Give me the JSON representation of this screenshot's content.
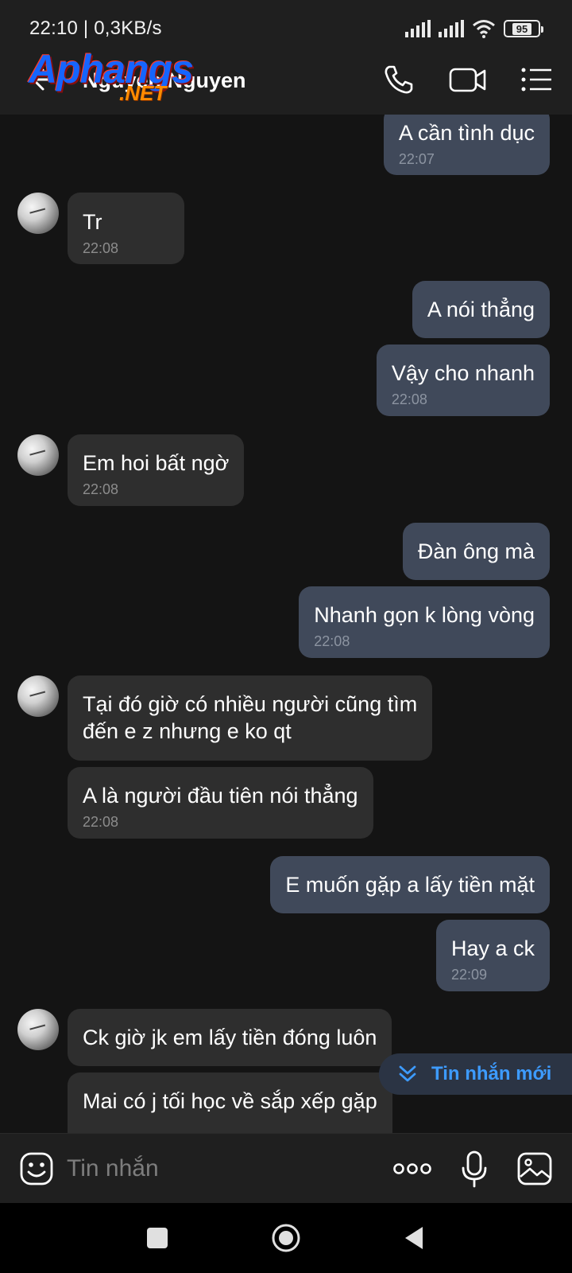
{
  "status_bar": {
    "time_speed": "22:10 | 0,3KB/s",
    "battery": "95"
  },
  "header": {
    "title": "Nguyen Nguyen",
    "watermark_main": "Aphangs",
    "watermark_sub": ".NET",
    "icons": [
      "phone-icon",
      "video-call-icon",
      "menu-list-icon"
    ]
  },
  "messages": [
    {
      "direction": "out",
      "text": "A cần tình dục",
      "time": "22:07"
    },
    {
      "direction": "in",
      "text": "Tr",
      "time": "22:08"
    },
    {
      "direction": "out",
      "text": "A nói thẳng",
      "time": ""
    },
    {
      "direction": "out",
      "text": "Vậy cho nhanh",
      "time": "22:08"
    },
    {
      "direction": "in",
      "text": "Em hoi bất ngờ",
      "time": "22:08"
    },
    {
      "direction": "out",
      "text": "Đàn ông mà",
      "time": ""
    },
    {
      "direction": "out",
      "text": "Nhanh gọn k lòng vòng",
      "time": "22:08"
    },
    {
      "direction": "in",
      "text": "Tại đó giờ có nhiều người cũng tìm\nđến e z nhưng e ko qt",
      "time": ""
    },
    {
      "direction": "in",
      "text": "A là người đầu tiên nói thẳng",
      "time": "22:08"
    },
    {
      "direction": "out",
      "text": "E muốn gặp a lấy tiền mặt",
      "time": ""
    },
    {
      "direction": "out",
      "text": "Hay a ck",
      "time": "22:09"
    },
    {
      "direction": "in",
      "text": "Ck giờ jk em lấy tiền đóng luôn",
      "time": ""
    },
    {
      "direction": "in",
      "text": "Mai có j tối học về sắp xếp gặp",
      "time": ""
    }
  ],
  "new_message_pill": {
    "label": "Tin nhắn mới"
  },
  "input": {
    "placeholder": "Tin nhắn"
  },
  "colors": {
    "background": "#141414",
    "bar": "#1f1f1f",
    "bubble_out": "#40495a",
    "bubble_in": "#2e2e2e",
    "accent": "#3d9bff"
  }
}
